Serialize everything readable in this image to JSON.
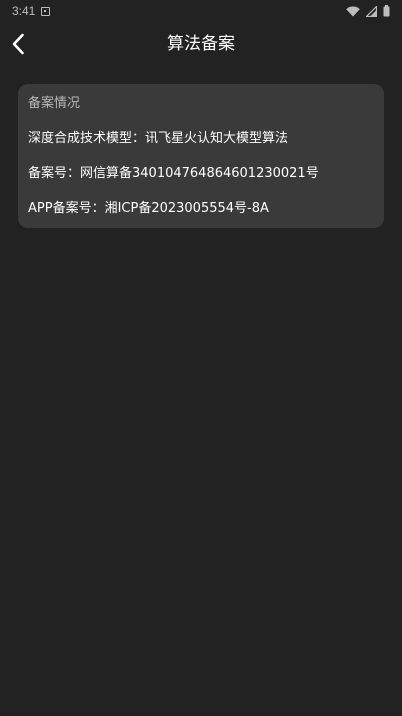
{
  "status_bar": {
    "time": "3:41"
  },
  "header": {
    "title": "算法备案"
  },
  "card": {
    "heading": "备案情况",
    "lines": [
      "深度合成技术模型：讯飞星火认知大模型算法",
      "备案号：网信算备340104764864601230021号",
      "APP备案号：湘ICP备2023005554号-8A"
    ]
  },
  "colors": {
    "background": "#222222",
    "card": "#3a3a3a",
    "text_primary": "#ffffff",
    "text_secondary": "#b8b8b8"
  },
  "icons": {
    "back": "chevron-left-icon",
    "wifi": "wifi-icon",
    "signal": "signal-icon",
    "battery": "battery-icon",
    "notification": "notification-icon"
  }
}
